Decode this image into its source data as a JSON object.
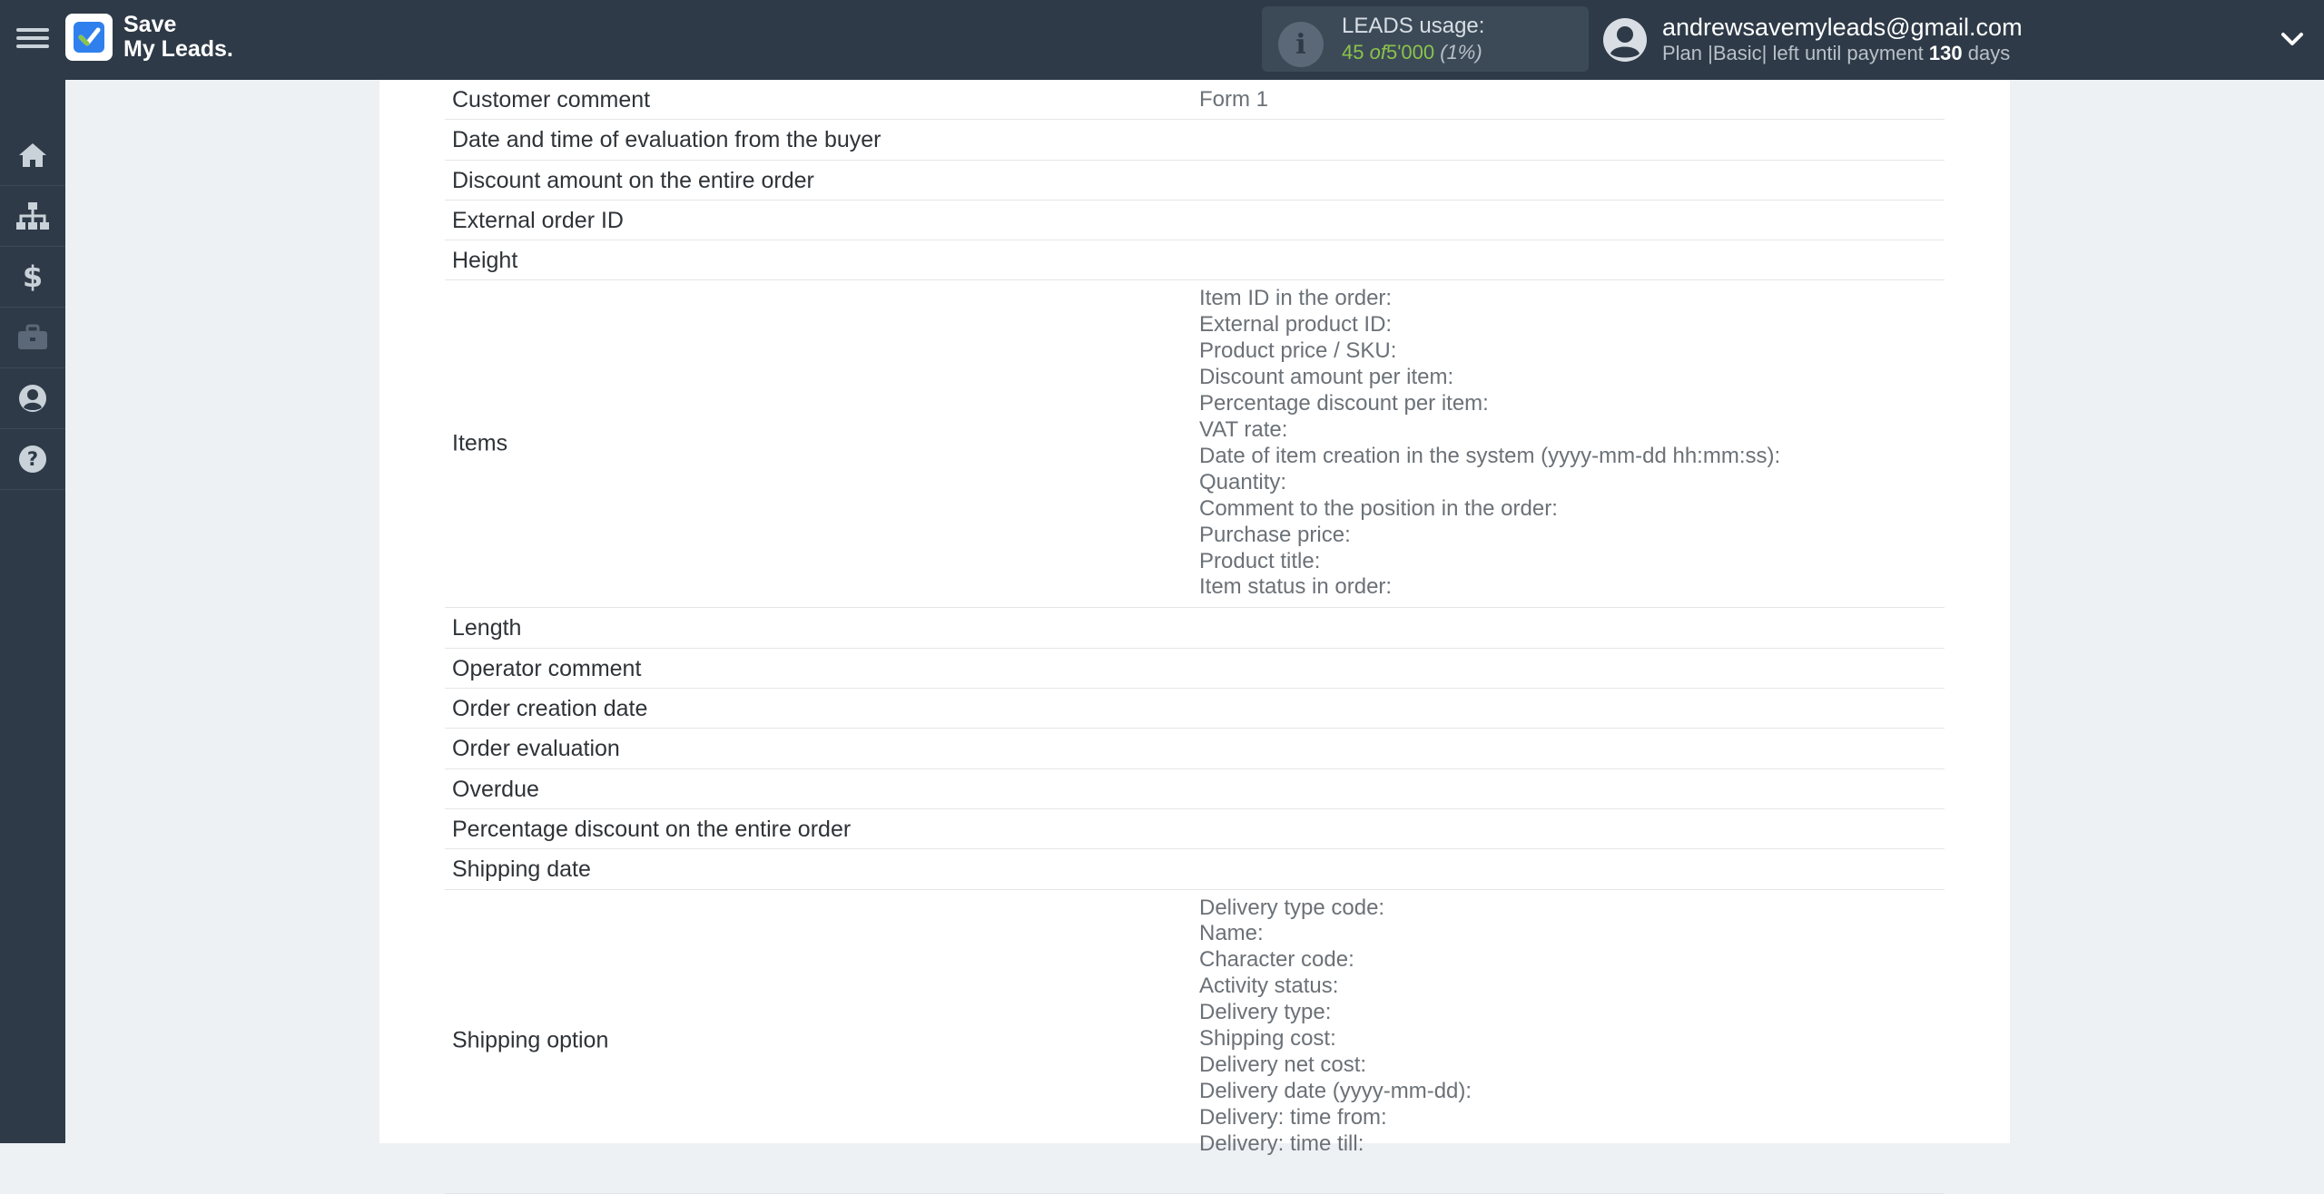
{
  "brand": {
    "line1": "Save",
    "line2": "My Leads."
  },
  "usage": {
    "title": "LEADS usage:",
    "used": "45",
    "of": "of",
    "total": "5'000",
    "percent": "(1%)"
  },
  "account": {
    "email": "andrewsavemyleads@gmail.com",
    "plan_prefix": "Plan |Basic| left until payment",
    "days_number": "130",
    "days_suffix": "days"
  },
  "sidebar": {
    "items": [
      {
        "icon": "home-icon"
      },
      {
        "icon": "sitemap-icon"
      },
      {
        "icon": "dollar-icon"
      },
      {
        "icon": "briefcase-icon"
      },
      {
        "icon": "user-circle-icon"
      },
      {
        "icon": "question-circle-icon"
      }
    ]
  },
  "fields": {
    "customer_comment": {
      "label": "Customer comment",
      "value": "Form 1"
    },
    "evaluation_date": {
      "label": "Date and time of evaluation from the buyer"
    },
    "discount_amount": {
      "label": "Discount amount on the entire order"
    },
    "external_order_id": {
      "label": "External order ID"
    },
    "height": {
      "label": "Height"
    },
    "items": {
      "label": "Items",
      "sub": [
        "Item ID in the order:",
        "External product ID:",
        "Product price / SKU:",
        "Discount amount per item:",
        "Percentage discount per item:",
        "VAT rate:",
        "Date of item creation in the system (yyyy-mm-dd hh:mm:ss):",
        "Quantity:",
        "Comment to the position in the order:",
        "Purchase price:",
        "Product title:",
        "Item status in order:"
      ]
    },
    "length": {
      "label": "Length"
    },
    "operator_comment": {
      "label": "Operator comment"
    },
    "order_creation_date": {
      "label": "Order creation date"
    },
    "order_evaluation": {
      "label": "Order evaluation"
    },
    "overdue": {
      "label": "Overdue"
    },
    "percentage_discount": {
      "label": "Percentage discount on the entire order"
    },
    "shipping_date": {
      "label": "Shipping date"
    },
    "shipping_option": {
      "label": "Shipping option",
      "sub": [
        "Delivery type code:",
        "Name:",
        "Character code:",
        "Activity status:",
        "Delivery type:",
        "Shipping cost:",
        "Delivery net cost:",
        "Delivery date (yyyy-mm-dd):",
        "Delivery: time from:",
        "Delivery: time till:"
      ]
    }
  },
  "colors": {
    "header_bg": "#2e3a47",
    "accent_green": "#8bc34a",
    "page_bg": "#eef1f4"
  }
}
